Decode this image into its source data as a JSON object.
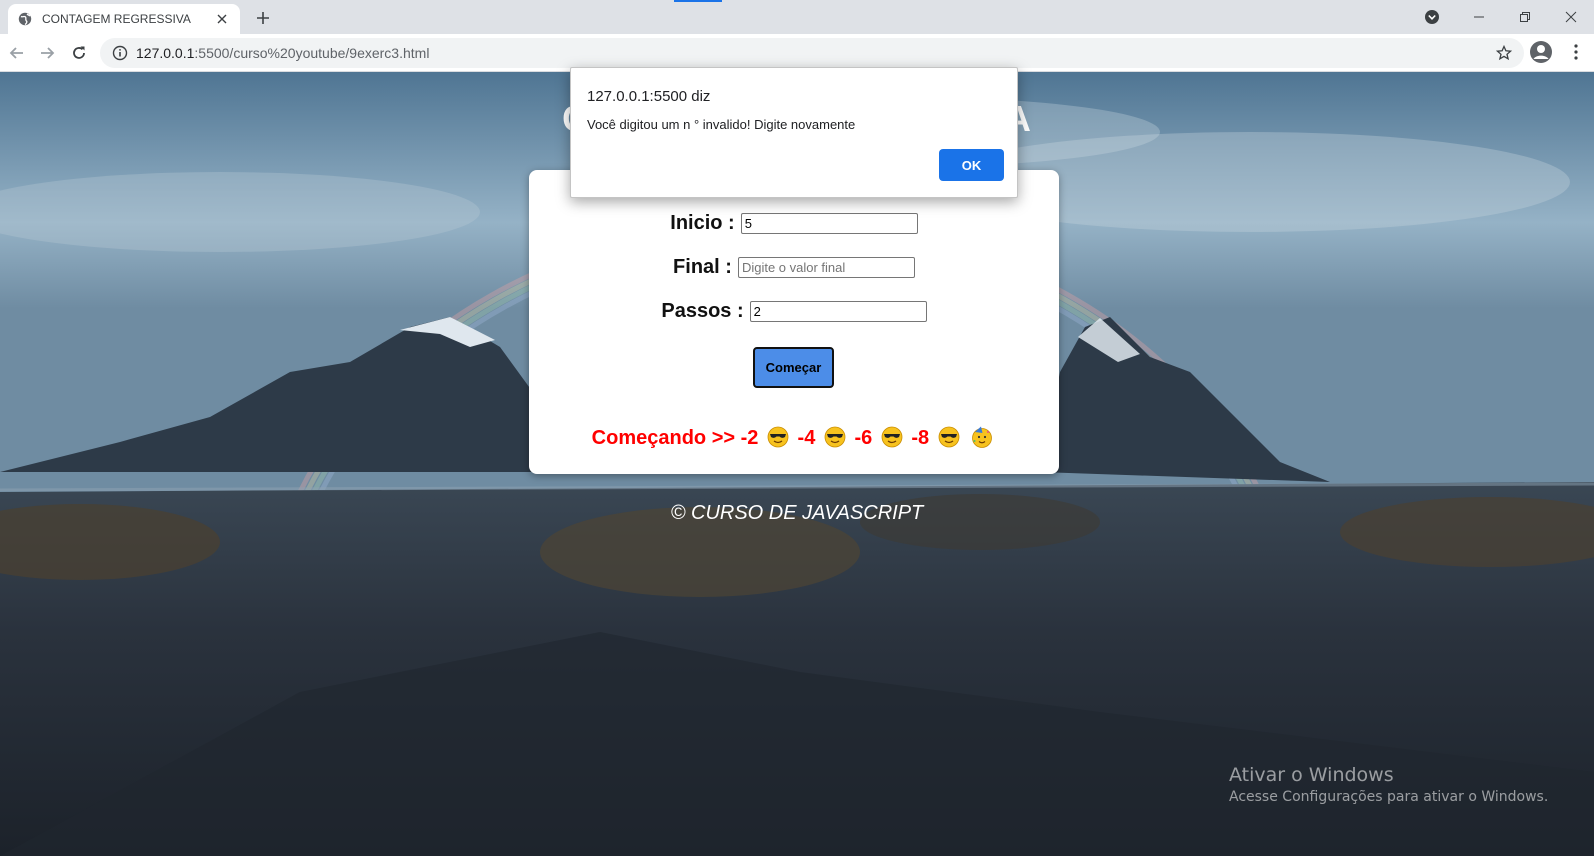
{
  "browser": {
    "tab_title": "CONTAGEM REGRESSIVA",
    "url_host": "127.0.0.1",
    "url_rest": ":5500/curso%20youtube/9exerc3.html"
  },
  "page": {
    "title": "CONTAGEM REGRESSIVA",
    "form": {
      "inicio_label": "Inicio :",
      "inicio_value": "5",
      "final_label": "Final :",
      "final_placeholder": "Digite o valor final",
      "final_value": "",
      "passos_label": "Passos :",
      "passos_value": "2",
      "start_button": "Começar"
    },
    "result": {
      "prefix": "Começando >>",
      "steps": [
        "-2",
        "-4",
        "-6",
        "-8"
      ],
      "step_icon": "sunglasses-emoji-icon",
      "end_icon": "party-face-emoji-icon"
    },
    "footer": "© CURSO DE JAVASCRIPT"
  },
  "dialog": {
    "origin": "127.0.0.1:5500 diz",
    "message": "Você digitou um n ° invalido! Digite novamente",
    "ok_label": "OK"
  },
  "watermark": {
    "title": "Ativar o Windows",
    "subtitle": "Acesse Configurações para ativar o Windows."
  },
  "colors": {
    "accent": "#1a73e8",
    "button": "#4c8de8",
    "result_text": "#ff0000"
  }
}
